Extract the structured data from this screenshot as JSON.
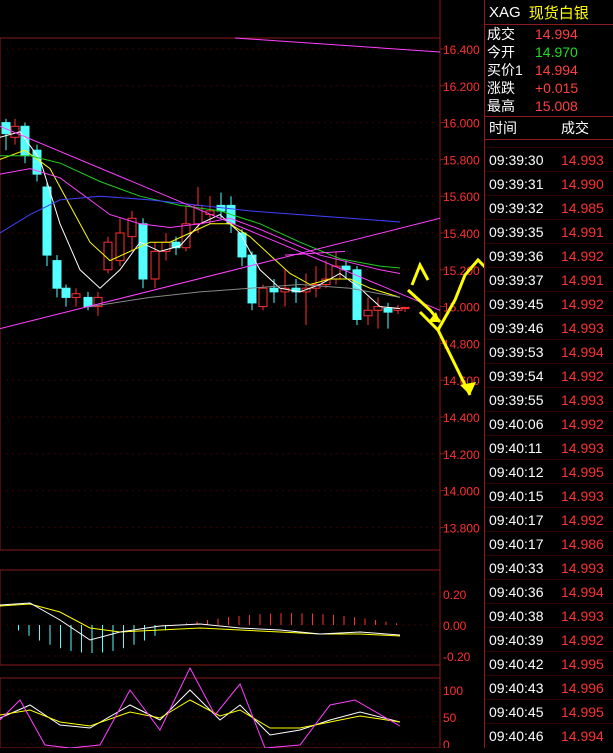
{
  "header": {
    "symbol": "XAG",
    "name": "现货白银"
  },
  "quote": [
    {
      "label": "成交",
      "value": "14.994",
      "color": "red"
    },
    {
      "label": "今开",
      "value": "14.970",
      "color": "green"
    },
    {
      "label": "买价1",
      "value": "14.994",
      "color": "red"
    },
    {
      "label": "涨跌",
      "value": "+0.015",
      "color": "red"
    },
    {
      "label": "最高",
      "value": "15.008",
      "color": "red"
    }
  ],
  "list_header": {
    "time": "时间",
    "price": "成交"
  },
  "ticks": [
    {
      "time": "09:39:30",
      "price": "14.993"
    },
    {
      "time": "09:39:31",
      "price": "14.990"
    },
    {
      "time": "09:39:32",
      "price": "14.985"
    },
    {
      "time": "09:39:35",
      "price": "14.991"
    },
    {
      "time": "09:39:36",
      "price": "14.992"
    },
    {
      "time": "09:39:37",
      "price": "14.991"
    },
    {
      "time": "09:39:45",
      "price": "14.992"
    },
    {
      "time": "09:39:46",
      "price": "14.993"
    },
    {
      "time": "09:39:53",
      "price": "14.994"
    },
    {
      "time": "09:39:54",
      "price": "14.992"
    },
    {
      "time": "09:39:55",
      "price": "14.993"
    },
    {
      "time": "09:40:06",
      "price": "14.992"
    },
    {
      "time": "09:40:11",
      "price": "14.993"
    },
    {
      "time": "09:40:12",
      "price": "14.995"
    },
    {
      "time": "09:40:15",
      "price": "14.993"
    },
    {
      "time": "09:40:17",
      "price": "14.992"
    },
    {
      "time": "09:40:17",
      "price": "14.986"
    },
    {
      "time": "09:40:33",
      "price": "14.993"
    },
    {
      "time": "09:40:36",
      "price": "14.994"
    },
    {
      "time": "09:40:38",
      "price": "14.993"
    },
    {
      "time": "09:40:39",
      "price": "14.992"
    },
    {
      "time": "09:40:42",
      "price": "14.995"
    },
    {
      "time": "09:40:43",
      "price": "14.996"
    },
    {
      "time": "09:40:45",
      "price": "14.995"
    },
    {
      "time": "09:40:46",
      "price": "14.994"
    }
  ],
  "main_axis": [
    "16.400",
    "16.200",
    "16.000",
    "15.800",
    "15.600",
    "15.400",
    "15.200",
    "15.000",
    "14.800",
    "14.600",
    "14.400",
    "14.200",
    "14.000",
    "13.800"
  ],
  "macd_axis": [
    "0.20",
    "0.00",
    "-0.20"
  ],
  "kdj_axis": [
    "100",
    "50",
    "0"
  ],
  "colors": {
    "up": "#ff3030",
    "down": "#54ffff",
    "ma1": "#ffffff",
    "ma2": "#ffff00",
    "ma3": "#ff40ff",
    "ma4": "#22cc22",
    "ma5": "#4040ff",
    "annotation": "#ffff00",
    "grid": "#8b1a1a"
  }
}
